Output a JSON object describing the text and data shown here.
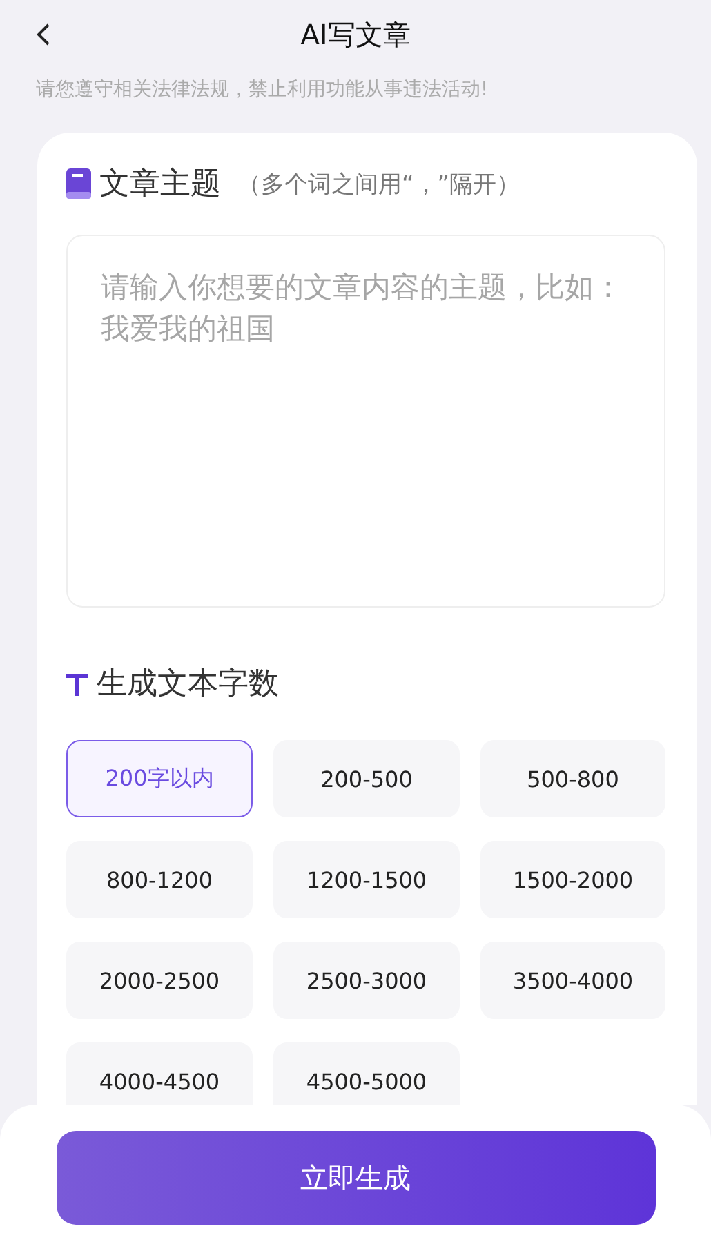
{
  "header": {
    "title": "AI写文章"
  },
  "notice": "请您遵守相关法律法规，禁止利用功能从事违法活动!",
  "topic": {
    "title": "文章主题",
    "hint": "（多个词之间用“，”隔开）",
    "placeholder": "请输入你想要的文章内容的主题，比如：我爱我的祖国"
  },
  "length": {
    "title": "生成文本字数",
    "options": [
      {
        "label": "200字以内",
        "selected": true
      },
      {
        "label": "200-500",
        "selected": false
      },
      {
        "label": "500-800",
        "selected": false
      },
      {
        "label": "800-1200",
        "selected": false
      },
      {
        "label": "1200-1500",
        "selected": false
      },
      {
        "label": "1500-2000",
        "selected": false
      },
      {
        "label": "2000-2500",
        "selected": false
      },
      {
        "label": "2500-3000",
        "selected": false
      },
      {
        "label": "3500-4000",
        "selected": false
      },
      {
        "label": "4000-4500",
        "selected": false
      },
      {
        "label": "4500-5000",
        "selected": false
      }
    ]
  },
  "generate_button": "立即生成"
}
